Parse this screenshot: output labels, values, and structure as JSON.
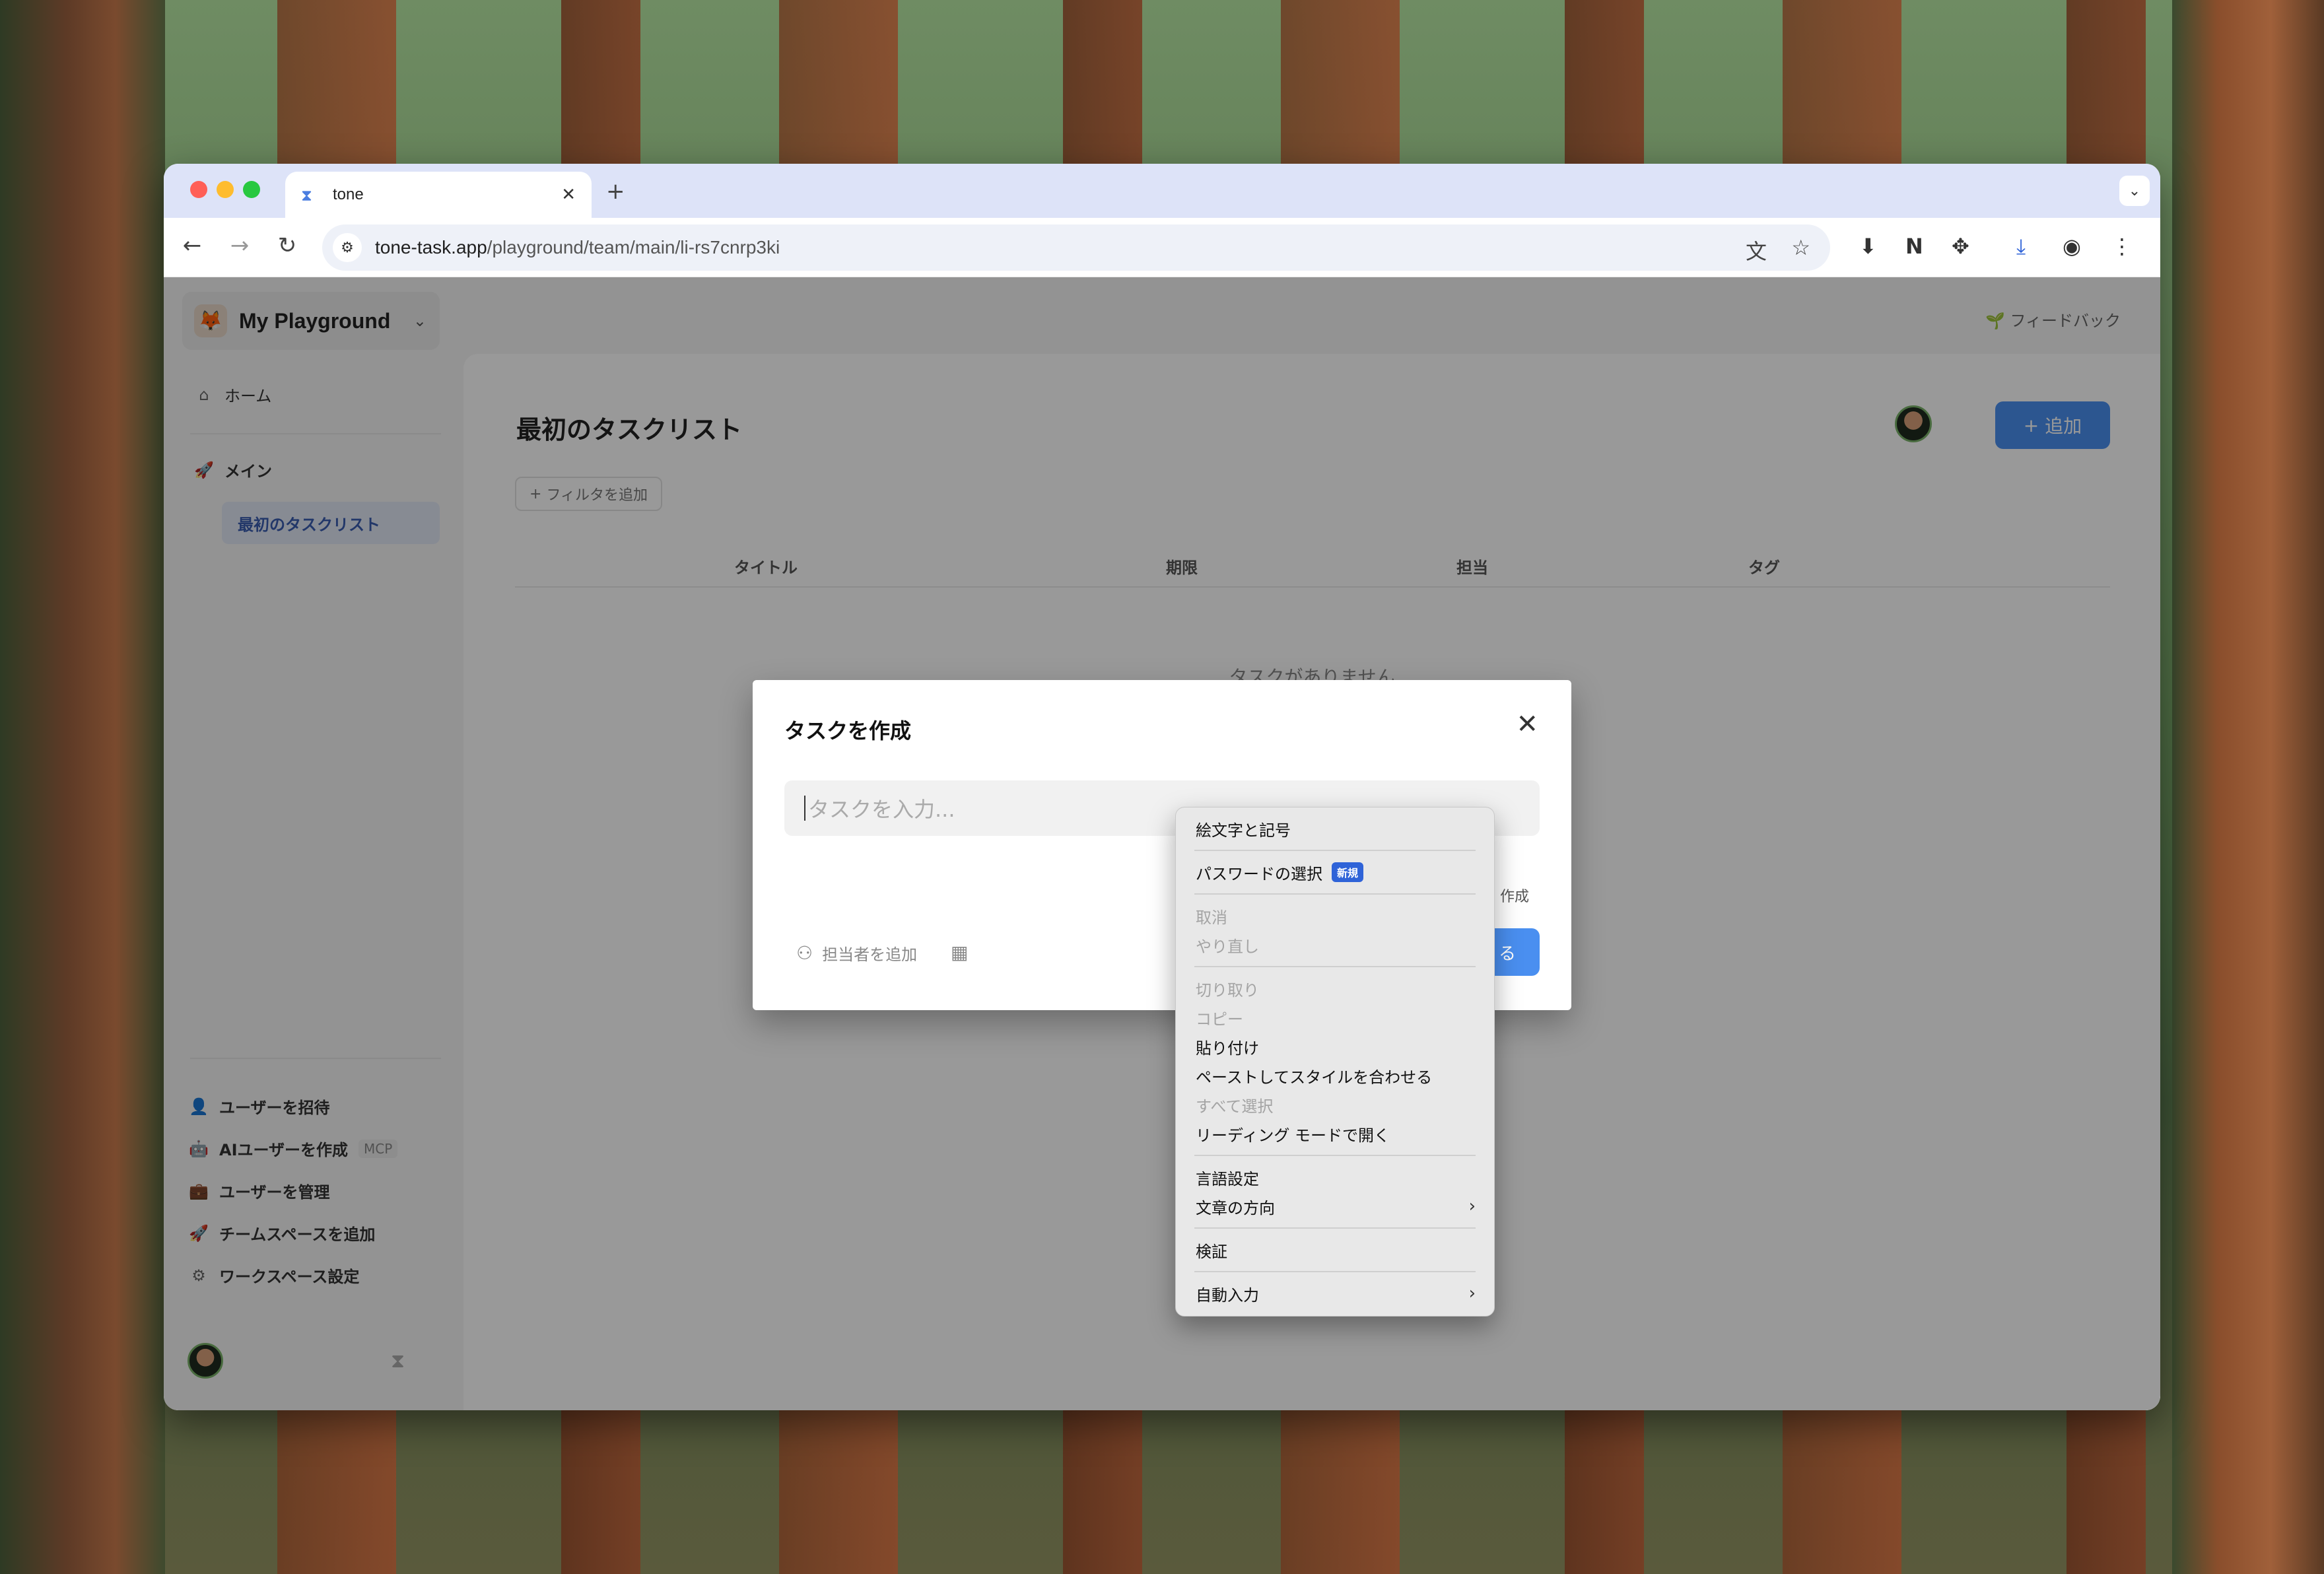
{
  "browser": {
    "tab_title": "tone",
    "url_host": "tone-task.app",
    "url_path": "/playground/team/main/li-rs7cnrp3ki"
  },
  "workspace": {
    "name": "My Playground"
  },
  "sidebar": {
    "home": "ホーム",
    "section_main": "メイン",
    "list_selected": "最初のタスクリスト",
    "bottom": [
      {
        "label": "ユーザーを招待"
      },
      {
        "label": "AIユーザーを作成",
        "badge": "MCP"
      },
      {
        "label": "ユーザーを管理"
      },
      {
        "label": "チームスペースを追加"
      },
      {
        "label": "ワークスペース設定"
      }
    ]
  },
  "header": {
    "feedback": "フィードバック"
  },
  "main": {
    "title": "最初のタスクリスト",
    "filter_label": "フィルタを追加",
    "add_button": "追加",
    "columns": [
      "タイトル",
      "期限",
      "担当",
      "タグ"
    ],
    "empty_text": "タスクがありません"
  },
  "dialog": {
    "title": "タスクを作成",
    "input_placeholder": "タスクを入力...",
    "assignee_label": "担当者を追加",
    "right_text": "作成",
    "submit_label": "る"
  },
  "context_menu": {
    "emoji": "絵文字と記号",
    "password": "パスワードの選択",
    "password_badge": "新規",
    "undo": "取消",
    "redo": "やり直し",
    "cut": "切り取り",
    "copy": "コピー",
    "paste": "貼り付け",
    "paste_match": "ペーストしてスタイルを合わせる",
    "select_all": "すべて選択",
    "reading_mode": "リーディング モードで開く",
    "language": "言語設定",
    "direction": "文章の方向",
    "inspect": "検証",
    "autofill": "自動入力"
  }
}
